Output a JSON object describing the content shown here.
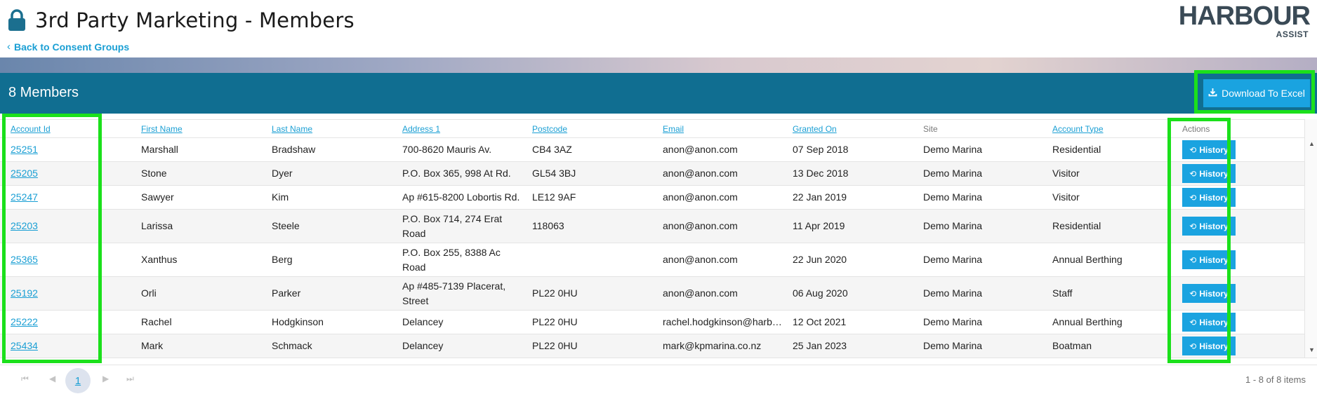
{
  "header": {
    "title": "3rd Party Marketing - Members",
    "back_link": "Back to Consent Groups",
    "logo_main": "HARBOUR",
    "logo_sub": "ASSIST"
  },
  "members_bar": {
    "count_label": "8 Members",
    "download_label": "Download To Excel"
  },
  "table": {
    "columns": [
      "Account Id",
      "First Name",
      "Last Name",
      "Address 1",
      "Postcode",
      "Email",
      "Granted On",
      "Site",
      "Account Type",
      "Actions"
    ],
    "action_label": "History",
    "rows": [
      {
        "account_id": "25251",
        "first_name": "Marshall",
        "last_name": "Bradshaw",
        "address1": "700-8620 Mauris Av.",
        "postcode": "CB4 3AZ",
        "email": "anon@anon.com",
        "granted_on": "07 Sep 2018",
        "site": "Demo Marina",
        "account_type": "Residential"
      },
      {
        "account_id": "25205",
        "first_name": "Stone",
        "last_name": "Dyer",
        "address1": "P.O. Box 365, 998 At Rd.",
        "postcode": "GL54 3BJ",
        "email": "anon@anon.com",
        "granted_on": "13 Dec 2018",
        "site": "Demo Marina",
        "account_type": "Visitor"
      },
      {
        "account_id": "25247",
        "first_name": "Sawyer",
        "last_name": "Kim",
        "address1": "Ap #615-8200 Lobortis Rd.",
        "postcode": "LE12 9AF",
        "email": "anon@anon.com",
        "granted_on": "22 Jan 2019",
        "site": "Demo Marina",
        "account_type": "Visitor"
      },
      {
        "account_id": "25203",
        "first_name": "Larissa",
        "last_name": "Steele",
        "address1": "P.O. Box 714, 274 Erat Road",
        "postcode": "118063",
        "email": "anon@anon.com",
        "granted_on": "11 Apr 2019",
        "site": "Demo Marina",
        "account_type": "Residential"
      },
      {
        "account_id": "25365",
        "first_name": "Xanthus",
        "last_name": "Berg",
        "address1": "P.O. Box 255, 8388 Ac Road",
        "postcode": "",
        "email": "anon@anon.com",
        "granted_on": "22 Jun 2020",
        "site": "Demo Marina",
        "account_type": "Annual Berthing"
      },
      {
        "account_id": "25192",
        "first_name": "Orli",
        "last_name": "Parker",
        "address1": "Ap #485-7139 Placerat, Street",
        "postcode": "PL22 0HU",
        "email": "anon@anon.com",
        "granted_on": "06 Aug 2020",
        "site": "Demo Marina",
        "account_type": "Staff"
      },
      {
        "account_id": "25222",
        "first_name": "Rachel",
        "last_name": "Hodgkinson",
        "address1": "Delancey",
        "postcode": "PL22 0HU",
        "email": "rachel.hodgkinson@harb…",
        "granted_on": "12 Oct 2021",
        "site": "Demo Marina",
        "account_type": "Annual Berthing"
      },
      {
        "account_id": "25434",
        "first_name": "Mark",
        "last_name": "Schmack",
        "address1": "Delancey",
        "postcode": "PL22 0HU",
        "email": "mark@kpmarina.co.nz",
        "granted_on": "25 Jan 2023",
        "site": "Demo Marina",
        "account_type": "Boatman"
      }
    ]
  },
  "pager": {
    "current_page": "1",
    "info": "1 - 8 of 8 items"
  }
}
